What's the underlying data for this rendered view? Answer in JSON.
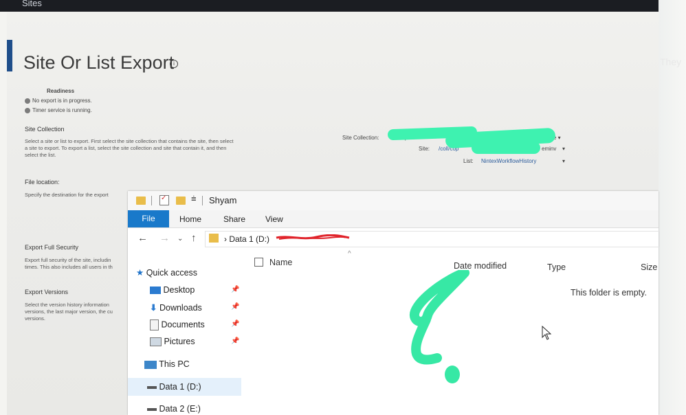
{
  "topbar": {
    "label": "Sites"
  },
  "ghost_text": "They",
  "page": {
    "title": "Site Or List Export",
    "readiness_title": "Readiness",
    "readiness_items": [
      "No export is in progress.",
      "Timer service is running."
    ],
    "site_collection_head": "Site Collection",
    "site_collection_desc": [
      "Select a site or list to export.  First select the site collection that contains the site, then select",
      "a site to export. To export a list, select the site collection and site that contain it, and then",
      "select the list."
    ],
    "file_location_head": "File location:",
    "file_location_desc": "Specify the destination for the export",
    "export_security_head": "Export Full Security",
    "export_security_desc": [
      "Export full security of the site, includin",
      "times. This also includes all users in th"
    ],
    "export_versions_head": "Export Versions",
    "export_versions_desc": [
      "Select the version history information",
      "versions, the last major version, the cu",
      "versions."
    ],
    "form": {
      "site_collection_label": "Site Collection:",
      "site_collection_value": "https://",
      "site_label": "Site:",
      "site_value": "/coll/cop",
      "site_suffix": "eminv",
      "list_label": "List:",
      "list_value": "NintexWorkflowHistory"
    }
  },
  "explorer": {
    "title": "Shyam",
    "ribbon_tabs": {
      "file": "File",
      "home": "Home",
      "share": "Share",
      "view": "View"
    },
    "address": "Data 1 (D:)",
    "columns": {
      "name": "Name",
      "date": "Date modified",
      "type": "Type",
      "size": "Size"
    },
    "empty_message": "This folder is empty.",
    "nav": {
      "quick_access": "Quick access",
      "desktop": "Desktop",
      "downloads": "Downloads",
      "documents": "Documents",
      "pictures": "Pictures",
      "this_pc": "This PC",
      "data1": "Data 1 (D:)",
      "data2": "Data 2 (E:)"
    }
  },
  "colors": {
    "accent": "#1979ca",
    "redaction": "#3ef2b0",
    "folder": "#e9bd4a"
  }
}
